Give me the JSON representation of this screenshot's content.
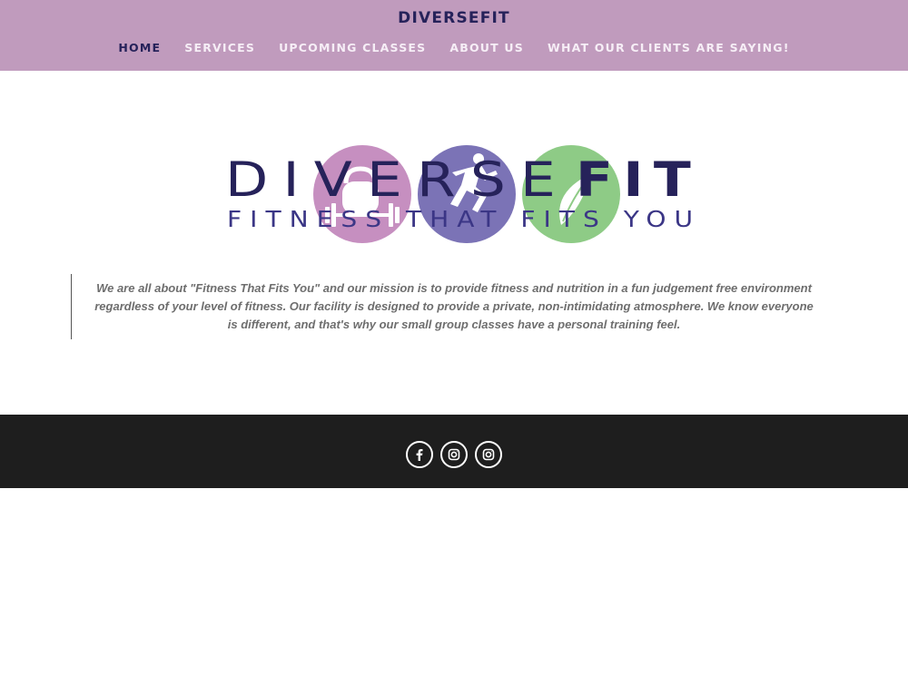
{
  "header": {
    "site_title": "DIVERSEFIT",
    "nav": [
      "HOME",
      "SERVICES",
      "UPCOMING CLASSES",
      "ABOUT US",
      "WHAT OUR CLIENTS ARE SAYING!"
    ],
    "active_index": 0
  },
  "logo": {
    "word_light": "DIVERSE",
    "word_bold": "FIT",
    "tagline": "FITNESS THAT FITS YOU",
    "colors": {
      "pink": "#c68fc0",
      "purple": "#7b73b6",
      "green": "#8ecb86",
      "navy": "#26225a"
    }
  },
  "mission": "We are all about \"Fitness That Fits You\" and our mission is to provide fitness and nutrition in a fun judgement free environment regardless of your level of fitness. Our facility is designed to provide a private, non-intimidating atmosphere. We know everyone is different, and that's why our small group classes have a personal training feel.",
  "footer": {
    "social": [
      "facebook-icon",
      "instagram-icon",
      "instagram-icon"
    ]
  },
  "colors": {
    "header_bg": "#c09bbd",
    "footer_bg": "#1e1e1e",
    "nav_active": "#26225a",
    "nav_text": "#f6eef6"
  }
}
